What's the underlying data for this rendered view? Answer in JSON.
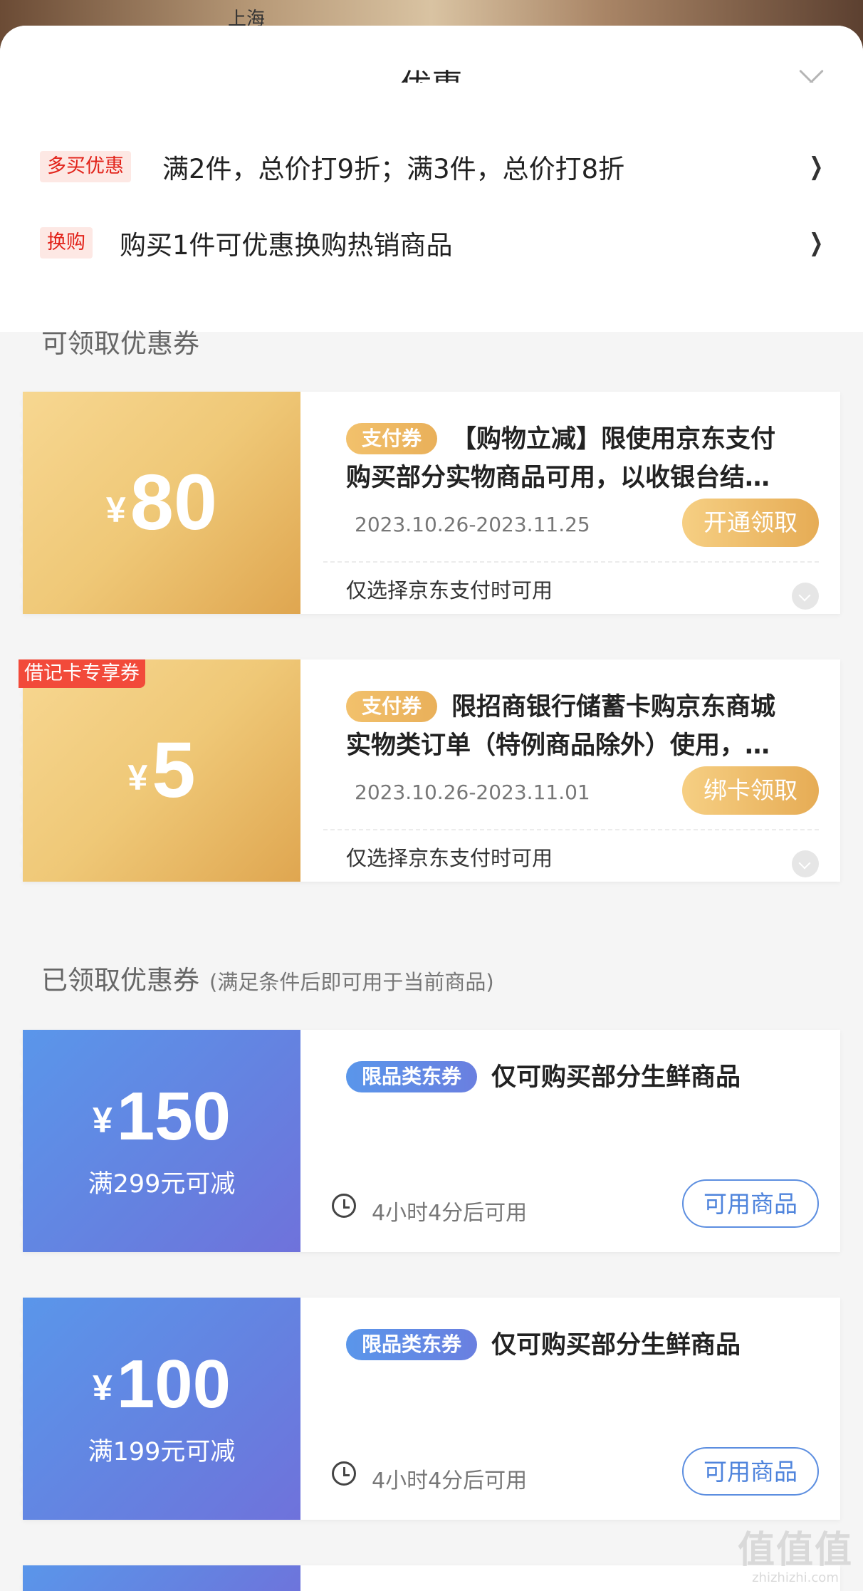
{
  "background": {
    "city_label": "上海"
  },
  "header": {
    "title": "优惠"
  },
  "promotions": [
    {
      "tag": "多买优惠",
      "text": "满2件，总价打9折；满3件，总价打8折"
    },
    {
      "tag": "换购",
      "text": "购买1件可优惠换购热销商品"
    }
  ],
  "available_section": {
    "title": "可领取优惠券"
  },
  "available_coupons": [
    {
      "currency": "¥",
      "amount": "80",
      "type_tag": "支付券",
      "description": "【购物立减】限使用京东支付购买部分实物商品可用，以收银台结…",
      "date_range": "2023.10.26-2023.11.25",
      "button": "开通领取",
      "note": "仅选择京东支付时可用",
      "corner_badge": ""
    },
    {
      "currency": "¥",
      "amount": "5",
      "type_tag": "支付券",
      "description": "限招商银行储蓄卡购京东商城实物类订单（特例商品除外）使用，…",
      "date_range": "2023.10.26-2023.11.01",
      "button": "绑卡领取",
      "note": "仅选择京东支付时可用",
      "corner_badge": "借记卡专享券"
    }
  ],
  "claimed_section": {
    "title": "已领取优惠券",
    "subtitle": "(满足条件后即可用于当前商品)"
  },
  "claimed_coupons": [
    {
      "currency": "¥",
      "amount": "150",
      "condition": "满299元可减",
      "type_tag": "限品类东券",
      "description": "仅可购买部分生鲜商品",
      "time_text": "4小时4分后可用",
      "button": "可用商品"
    },
    {
      "currency": "¥",
      "amount": "100",
      "condition": "满199元可减",
      "type_tag": "限品类东券",
      "description": "仅可购买部分生鲜商品",
      "time_text": "4小时4分后可用",
      "button": "可用商品"
    }
  ],
  "watermark": {
    "main": "值值值",
    "sub": "zhizhizhi.com"
  },
  "colors": {
    "gold_accent": "#e9b05a",
    "blue_accent": "#6581e0",
    "tag_red": "#e2231a"
  }
}
